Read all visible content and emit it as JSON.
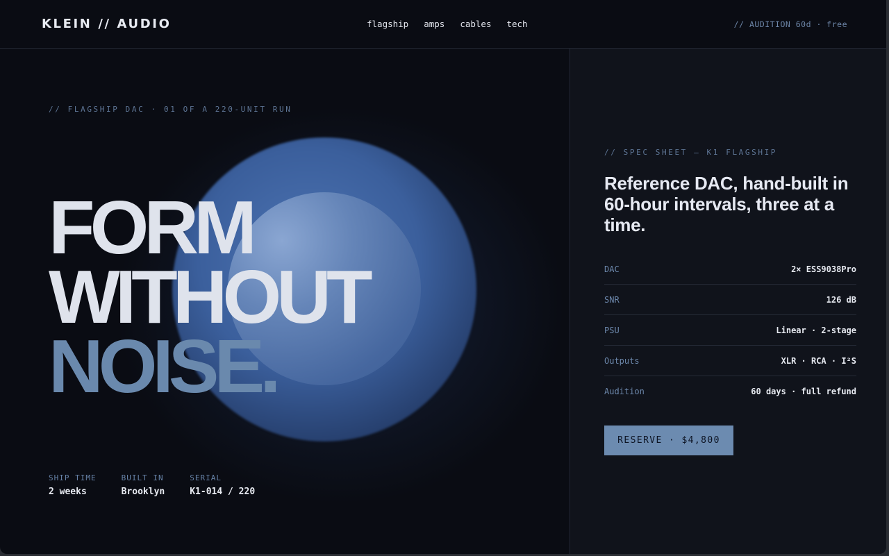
{
  "header": {
    "logo": "KLEIN // AUDIO",
    "nav": [
      "flagship",
      "amps",
      "cables",
      "tech"
    ],
    "audition_note": "// AUDITION 60d · free"
  },
  "hero": {
    "eyebrow": "// FLAGSHIP DAC · 01 OF A 220-UNIT RUN",
    "headline": [
      "FORM",
      "WITHOUT",
      "NOISE."
    ],
    "stats": [
      {
        "label": "SHIP TIME",
        "value": "2 weeks"
      },
      {
        "label": "BUILT IN",
        "value": "Brooklyn"
      },
      {
        "label": "SERIAL",
        "value": "K1-014 / 220"
      }
    ]
  },
  "spec_sheet": {
    "eyebrow": "// SPEC SHEET — K1 FLAGSHIP",
    "title": "Reference DAC, hand-built in 60-hour intervals, three at a time.",
    "rows": [
      {
        "key": "DAC",
        "value": "2× ESS9038Pro"
      },
      {
        "key": "SNR",
        "value": "126 dB"
      },
      {
        "key": "PSU",
        "value": "Linear · 2-stage"
      },
      {
        "key": "Outputs",
        "value": "XLR · RCA · I²S"
      },
      {
        "key": "Audition",
        "value": "60 days · full refund"
      }
    ],
    "cta_label": "RESERVE · $4,800"
  },
  "colors": {
    "background": "#0a0c13",
    "panel": "#10131b",
    "accent": "#6c8bb0",
    "orb": "#4d74b3"
  }
}
